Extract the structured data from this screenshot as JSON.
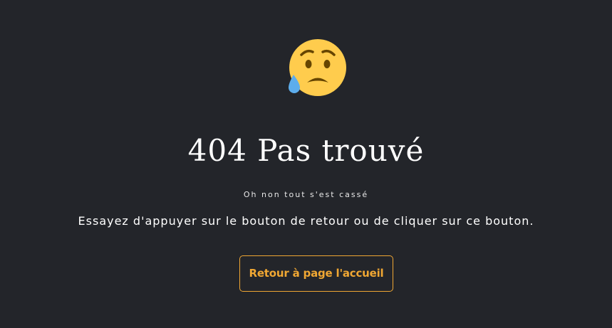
{
  "error_page": {
    "emoji": "sad-but-relieved-face-icon",
    "title": "404 Pas trouvé",
    "subtitle": "Oh non tout s'est cassé",
    "message": "Essayez d'appuyer sur le bouton de retour ou de cliquer sur ce bouton.",
    "home_button_label": "Retour à page l'accueil"
  },
  "colors": {
    "background": "#23252a",
    "text": "#ffffff",
    "accent": "#f0a733",
    "emoji_face": "#ffcc4d",
    "emoji_tear": "#5dadec",
    "emoji_features": "#664500"
  }
}
